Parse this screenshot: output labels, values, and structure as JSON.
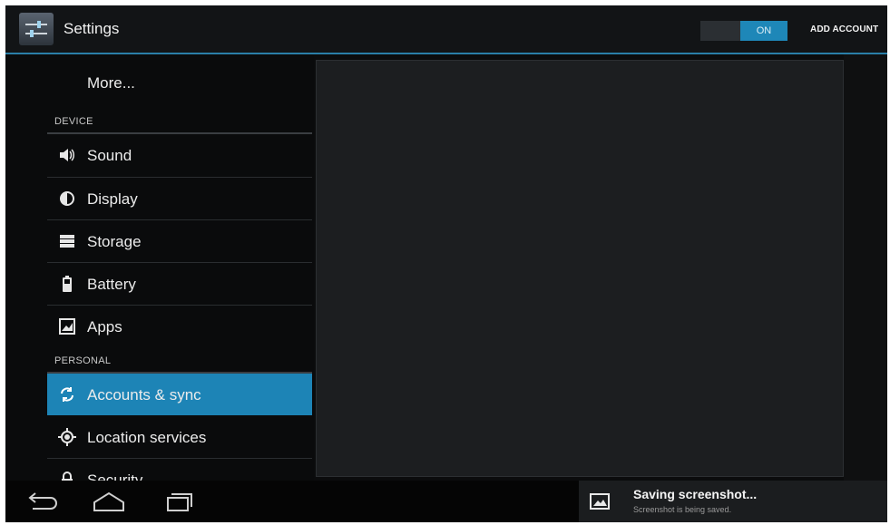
{
  "action_bar": {
    "title": "Settings",
    "toggle_label": "ON",
    "add_account_label": "ADD ACCOUNT",
    "accent": "#1e87b8"
  },
  "settings_list": {
    "more_label": "More...",
    "device_header": "DEVICE",
    "personal_header": "PERSONAL",
    "items": [
      {
        "label": "Sound",
        "icon": "speaker-icon"
      },
      {
        "label": "Display",
        "icon": "brightness-icon"
      },
      {
        "label": "Storage",
        "icon": "storage-icon"
      },
      {
        "label": "Battery",
        "icon": "battery-icon"
      },
      {
        "label": "Apps",
        "icon": "apps-icon"
      },
      {
        "label": "Accounts & sync",
        "icon": "sync-icon",
        "selected": true
      },
      {
        "label": "Location services",
        "icon": "location-icon"
      },
      {
        "label": "Security",
        "icon": "lock-icon"
      }
    ],
    "selected_color": "#1d84b6"
  },
  "notification": {
    "title": "Saving screenshot...",
    "subtitle": "Screenshot is being saved.",
    "icon": "image-icon"
  },
  "navigation": {
    "buttons": [
      "back-icon",
      "home-icon",
      "recent-apps-icon"
    ]
  }
}
